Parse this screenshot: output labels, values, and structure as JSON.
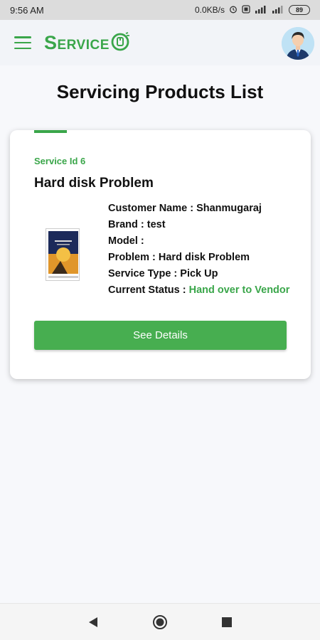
{
  "status_bar": {
    "time": "9:56 AM",
    "speed": "0.0KB/s",
    "battery": "89",
    "icons": [
      "alarm-icon",
      "data-saver-icon",
      "signal-icon",
      "signal-icon",
      "battery-icon"
    ]
  },
  "app_bar": {
    "logo_text": "Service",
    "icons": [
      "menu-icon",
      "logo-icon",
      "avatar"
    ]
  },
  "page": {
    "title": "Servicing Products List"
  },
  "card": {
    "service_id": "Service Id 6",
    "title": "Hard disk Problem",
    "customer_name": "Customer Name : Shanmugaraj",
    "brand": "Brand : test",
    "model": "Model :",
    "problem": "Problem : Hard disk Problem",
    "service_type": "Service Type : Pick Up",
    "status_label": "Current Status :",
    "status_value": "Hand over to Vendor",
    "button_label": "See Details"
  },
  "nav_bar": {
    "icons": [
      "back-icon",
      "home-icon",
      "recents-icon"
    ]
  },
  "colors": {
    "accent": "#3aa64a",
    "button": "#47ae50",
    "status_bar": "#dcdcdc",
    "background": "#f7f8fb"
  }
}
